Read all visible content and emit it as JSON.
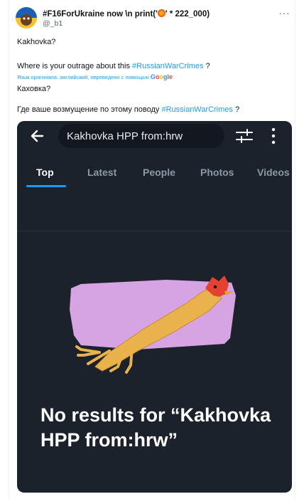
{
  "post": {
    "author_name_prefix": "#F16ForUkraine now \\n print('",
    "author_name_suffix": "' * 222_000)",
    "handle": "@_b1",
    "more_label": "···",
    "lines": {
      "line1": "Kakhovka?",
      "line2_text": "Where is your outrage about this ",
      "line2_hashtag": "#RussianWarCrimes",
      "line2_end": " ?",
      "translated_note": "Язык оригинала: английский, переведено с помощью ",
      "translated_brand": "Google",
      "line3": "Каховка?",
      "line4_text": "Где ваше возмущение по этому поводу ",
      "line4_hashtag": "#RussianWarCrimes",
      "line4_end": " ?"
    }
  },
  "screenshot": {
    "search_query": "Kakhovka HPP from:hrw",
    "tabs": [
      "Top",
      "Latest",
      "People",
      "Photos",
      "Videos"
    ],
    "active_tab": "Top",
    "empty_title": "No results for “Kakhovka HPP from:hrw”",
    "accent": "#1d9bf0",
    "background": "#1c222c"
  },
  "icons": [
    "back-arrow-icon",
    "filter-icon",
    "more-vertical-icon",
    "rubber-chicken-illustration",
    "more-icon",
    "google-logo"
  ]
}
